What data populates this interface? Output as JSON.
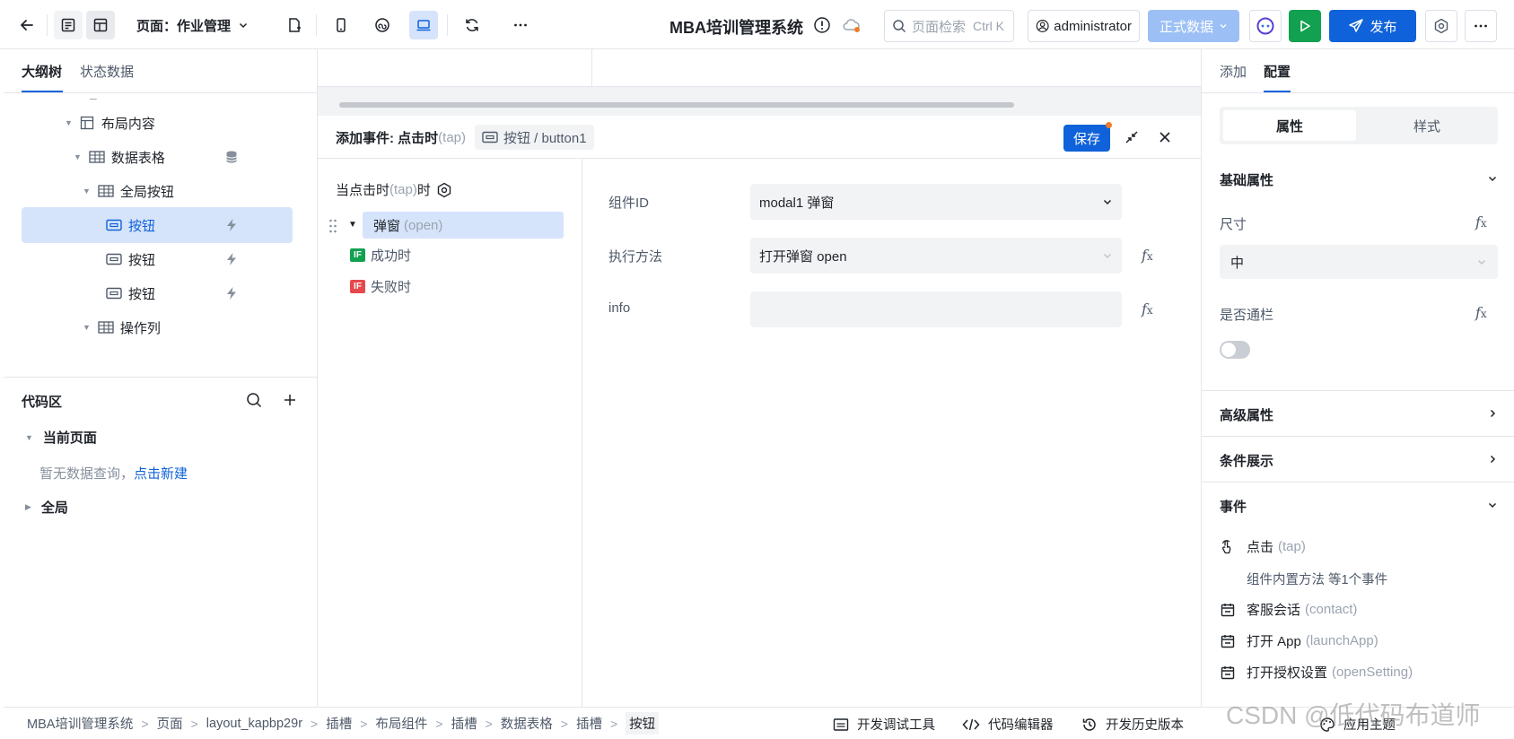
{
  "topbar": {
    "page_label": "页面：作业管理",
    "app_title": "MBA培训管理系统",
    "search_placeholder": "页面检索",
    "search_shortcut": "Ctrl K",
    "user": "administrator",
    "env_label": "正式数据",
    "publish_label": "发布"
  },
  "left": {
    "tabs": [
      "大纲树",
      "状态数据"
    ],
    "tree_collapsed_mark": "–",
    "tree": [
      {
        "label": "布局内容"
      },
      {
        "label": "数据表格"
      },
      {
        "label": "全局按钮"
      },
      {
        "label": "按钮"
      },
      {
        "label": "按钮"
      },
      {
        "label": "按钮"
      },
      {
        "label": "操作列"
      }
    ],
    "code_area": {
      "title": "代码区",
      "current_page": "当前页面",
      "empty_text": "暂无数据查询，",
      "create_link": "点击新建",
      "global": "全局"
    }
  },
  "event": {
    "title_prefix": "添加事件: 点击时",
    "title_event": "(tap)",
    "component_path": "按钮 / button1",
    "save_label": "保存",
    "trigger_prefix": "当点击时",
    "trigger_event": "(tap)",
    "trigger_suffix": "时",
    "action_label": "弹窗",
    "action_method": "(open)",
    "if_badge": "IF",
    "success_label": "成功时",
    "fail_label": "失败时",
    "fields": [
      {
        "label": "组件ID",
        "value": "modal1 弹窗"
      },
      {
        "label": "执行方法",
        "value": "打开弹窗 open"
      },
      {
        "label": "info",
        "value": ""
      }
    ]
  },
  "right": {
    "tabs": [
      "添加",
      "配置"
    ],
    "segments": [
      "属性",
      "样式"
    ],
    "basic_title": "基础属性",
    "size_label": "尺寸",
    "size_value": "中",
    "banner_label": "是否通栏",
    "advanced_title": "高级属性",
    "condition_title": "条件展示",
    "events_title": "事件",
    "events": [
      {
        "name": "点击",
        "code": "(tap)"
      },
      {
        "name": "客服会话",
        "code": "(contact)"
      },
      {
        "name": "打开 App",
        "code": "(launchApp)"
      },
      {
        "name": "打开授权设置",
        "code": "(openSetting)"
      }
    ],
    "builtin_note": "组件内置方法 等1个事件"
  },
  "bottombar": {
    "breadcrumb": [
      "MBA培训管理系统",
      "页面",
      "layout_kapbp29r",
      "插槽",
      "布局组件",
      "插槽",
      "数据表格",
      "插槽",
      "按钮"
    ],
    "tools": [
      "开发调试工具",
      "代码编辑器",
      "开发历史版本",
      "应用主题"
    ],
    "watermark": "CSDN @低代码布道师"
  },
  "colors": {
    "primary": "#0f62d9",
    "green": "#12a150",
    "red": "#e5484d",
    "selected_bg": "#d6e4fb"
  }
}
